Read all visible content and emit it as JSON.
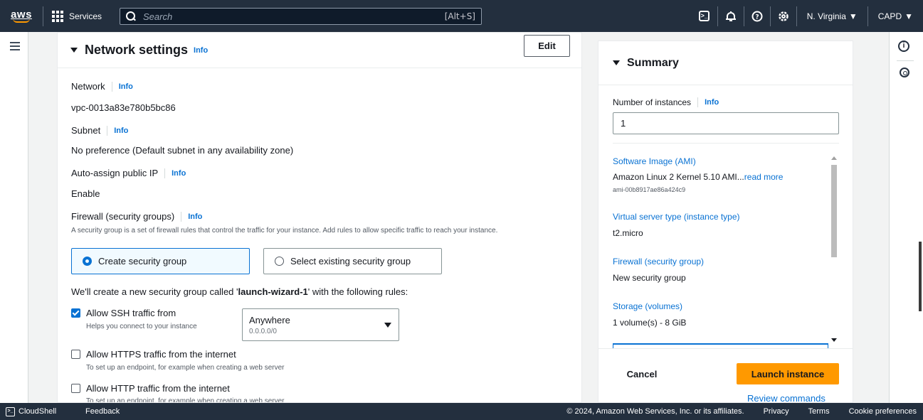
{
  "topnav": {
    "logo_text": "aws",
    "services_label": "Services",
    "search_placeholder": "Search",
    "search_shortcut": "[Alt+S]",
    "region_label": "N. Virginia",
    "account_label": "CAPD"
  },
  "network": {
    "title": "Network settings",
    "title_info": "Info",
    "edit_label": "Edit",
    "network_label": "Network",
    "network_info": "Info",
    "network_value": "vpc-0013a83e780b5bc86",
    "subnet_label": "Subnet",
    "subnet_info": "Info",
    "subnet_value": "No preference (Default subnet in any availability zone)",
    "autoip_label": "Auto-assign public IP",
    "autoip_info": "Info",
    "autoip_value": "Enable",
    "firewall_label": "Firewall (security groups)",
    "firewall_info": "Info",
    "firewall_desc": "A security group is a set of firewall rules that control the traffic for your instance. Add rules to allow specific traffic to reach your instance.",
    "radio_create": "Create security group",
    "radio_existing": "Select existing security group",
    "create_note_prefix": "We'll create a new security group called '",
    "create_note_name": "launch-wizard-1",
    "create_note_suffix": "' with the following rules:",
    "ssh_label": "Allow SSH traffic from",
    "ssh_desc": "Helps you connect to your instance",
    "ssh_checked": true,
    "ssh_source_main": "Anywhere",
    "ssh_source_sub": "0.0.0.0/0",
    "https_label": "Allow HTTPS traffic from the internet",
    "https_desc": "To set up an endpoint, for example when creating a web server",
    "http_label": "Allow HTTP traffic from the internet",
    "http_desc": "To set up an endpoint, for example when creating a web server"
  },
  "summary": {
    "title": "Summary",
    "num_instances_label": "Number of instances",
    "num_instances_info": "Info",
    "num_instances_value": "1",
    "ami_label": "Software Image (AMI)",
    "ami_value": "Amazon Linux 2 Kernel 5.10 AMI...",
    "ami_read_more": "read more",
    "ami_id": "ami-00b8917ae86a424c9",
    "type_label": "Virtual server type (instance type)",
    "type_value": "t2.micro",
    "firewall_label": "Firewall (security group)",
    "firewall_value": "New security group",
    "storage_label": "Storage (volumes)",
    "storage_value": "1 volume(s) - 8 GiB",
    "cancel_label": "Cancel",
    "launch_label": "Launch instance",
    "review_label": "Review commands"
  },
  "footer": {
    "cloudshell": "CloudShell",
    "feedback": "Feedback",
    "copyright": "© 2024, Amazon Web Services, Inc. or its affiliates.",
    "privacy": "Privacy",
    "terms": "Terms",
    "cookies": "Cookie preferences"
  },
  "colors": {
    "nav_bg": "#232f3e",
    "link": "#0972d3",
    "primary_button": "#ff9900"
  }
}
